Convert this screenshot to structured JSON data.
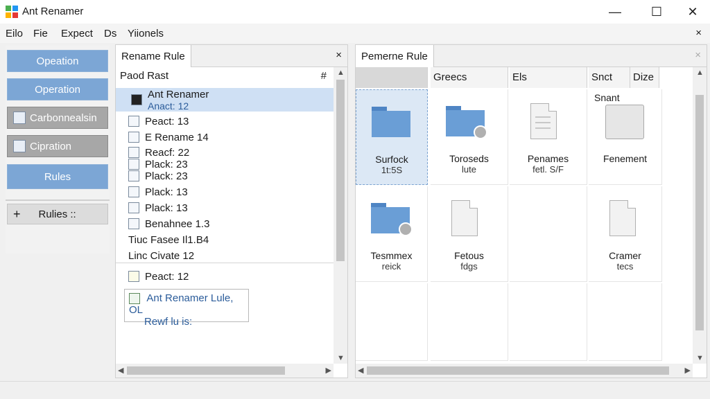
{
  "window": {
    "title": "Ant Renamer",
    "minimize": "—",
    "maximize": "☐",
    "close": "✕"
  },
  "menu": {
    "items": [
      "Eilo",
      "Fie",
      "Expect",
      "Ds",
      "Yiionels"
    ],
    "close": "×"
  },
  "sidebar": {
    "buttons": [
      {
        "label": "Opeation",
        "style": "blue"
      },
      {
        "label": "Operation",
        "style": "blue"
      },
      {
        "label": "Carbonnealsin",
        "style": "gray"
      },
      {
        "label": "Cipration",
        "style": "gray"
      },
      {
        "label": "Rules",
        "style": "blue"
      }
    ],
    "rules": {
      "plus": "+",
      "label": "Rulies ::"
    }
  },
  "middle_panel": {
    "tab": "Rename Rule",
    "close": "×",
    "header": {
      "label": "Paod Rast",
      "symbol": "#"
    },
    "items": [
      {
        "line1": "Ant Renamer",
        "line2": "Anact: 12"
      },
      {
        "line1": "Peact: 13"
      },
      {
        "line1": "E Rename 14"
      },
      {
        "line1": "Reacf: 22"
      },
      {
        "line1": "Plack: 23"
      },
      {
        "line1": "Plack: 23"
      },
      {
        "line1": "Plack: 13"
      },
      {
        "line1": "Plack: 13"
      },
      {
        "line1": "Benahnee 1.3"
      },
      {
        "line1": "Tiuc Fasee Il1.B4"
      },
      {
        "line1": "Linc Civate 12"
      },
      {
        "line1": "Peact: 12"
      }
    ],
    "link_box": {
      "line1": "Ant Renamer Lule, OL",
      "line2": "Rewf lu is:"
    }
  },
  "right_panel": {
    "tab": "Pemerne Rule",
    "close": "×",
    "columns": [
      "",
      "Greecs",
      "Els",
      "Snct",
      "Dize"
    ],
    "snant_label": "Snant",
    "files": [
      {
        "icon": "folder",
        "name": "Surfock",
        "detail": "1t:5S",
        "selected": true
      },
      {
        "icon": "folder-badge",
        "name": "Toroseds",
        "detail": "lute",
        "selected": false
      },
      {
        "icon": "document",
        "name": "Penames",
        "detail": "fetl. S/F",
        "selected": false
      },
      {
        "icon": "open-folder",
        "name": "Fenement",
        "detail": "",
        "selected": false
      },
      {
        "icon": "folder-badge",
        "name": "Tesmmex",
        "detail": "reick",
        "selected": false
      },
      {
        "icon": "document",
        "name": "Fetous",
        "detail": "fdgs",
        "selected": false
      },
      {
        "icon": "empty",
        "name": "",
        "detail": "",
        "selected": false
      },
      {
        "icon": "document",
        "name": "Cramer",
        "detail": "tecs",
        "selected": false
      }
    ]
  },
  "colors": {
    "accent_blue": "#7ca6d5",
    "selection": "#cfe0f4",
    "link": "#2b5c9a"
  }
}
